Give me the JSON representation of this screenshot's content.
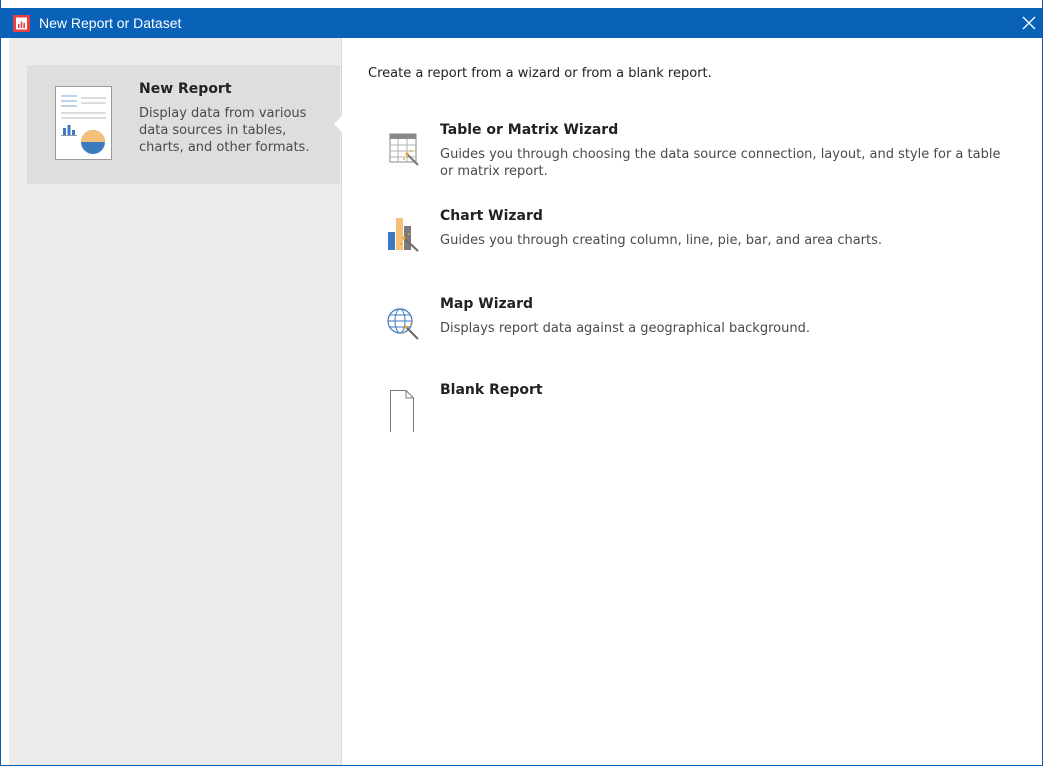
{
  "window": {
    "title": "New Report or Dataset",
    "accent_color": "#0a62b8"
  },
  "sidebar": {
    "categories": [
      {
        "title": "New Report",
        "description": "Display data from various data sources in tables, charts, and other formats.",
        "icon": "report-document-icon",
        "selected": true
      }
    ]
  },
  "main": {
    "intro": "Create a report from a wizard or from a blank report.",
    "options": [
      {
        "title": "Table or Matrix Wizard",
        "description": "Guides you through choosing the data source connection, layout, and style for a table or matrix report.",
        "icon": "table-wizard-icon"
      },
      {
        "title": "Chart Wizard",
        "description": "Guides you through creating column, line, pie, bar, and area charts.",
        "icon": "chart-wizard-icon"
      },
      {
        "title": "Map Wizard",
        "description": "Displays report data against a geographical background.",
        "icon": "map-wizard-icon"
      },
      {
        "title": "Blank Report",
        "description": "",
        "icon": "blank-page-icon"
      }
    ]
  }
}
